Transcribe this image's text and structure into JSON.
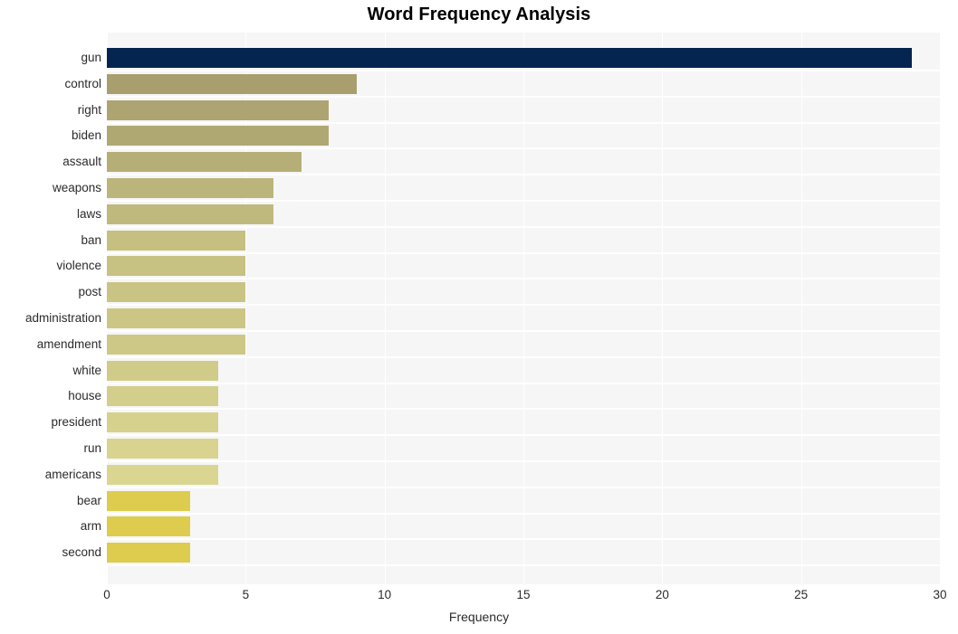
{
  "chart_data": {
    "type": "bar",
    "orientation": "horizontal",
    "title": "Word Frequency Analysis",
    "xlabel": "Frequency",
    "ylabel": "",
    "xlim": [
      0,
      30
    ],
    "ylim": [
      0,
      20
    ],
    "grid": true,
    "legend": null,
    "xticks": [
      0,
      5,
      10,
      15,
      20,
      25,
      30
    ],
    "xtick_labels": [
      "0",
      "5",
      "10",
      "15",
      "20",
      "25",
      "30"
    ],
    "categories": [
      "gun",
      "control",
      "right",
      "biden",
      "assault",
      "weapons",
      "laws",
      "ban",
      "violence",
      "post",
      "administration",
      "amendment",
      "white",
      "house",
      "president",
      "run",
      "americans",
      "bear",
      "arm",
      "second"
    ],
    "values": [
      29,
      9,
      8,
      8,
      7,
      6,
      6,
      5,
      5,
      5,
      5,
      5,
      4,
      4,
      4,
      4,
      4,
      3,
      3,
      3
    ],
    "bar_colors": [
      "#03254f",
      "#a89e6e",
      "#ada471",
      "#b0a873",
      "#b5ae76",
      "#bcb57b",
      "#c0b97d",
      "#c5bf80",
      "#c7c182",
      "#cac484",
      "#ccc685",
      "#cec887",
      "#d1cb89",
      "#d3ce8b",
      "#d6d18d",
      "#d8d48f",
      "#dad691",
      "#ddcc4e",
      "#ddcc4e",
      "#ddcc4e"
    ],
    "plot_background": "#f6f6f6",
    "gridline_color": "#ffffff",
    "figure_background": "#ffffff",
    "accent_color": "#03254f"
  }
}
